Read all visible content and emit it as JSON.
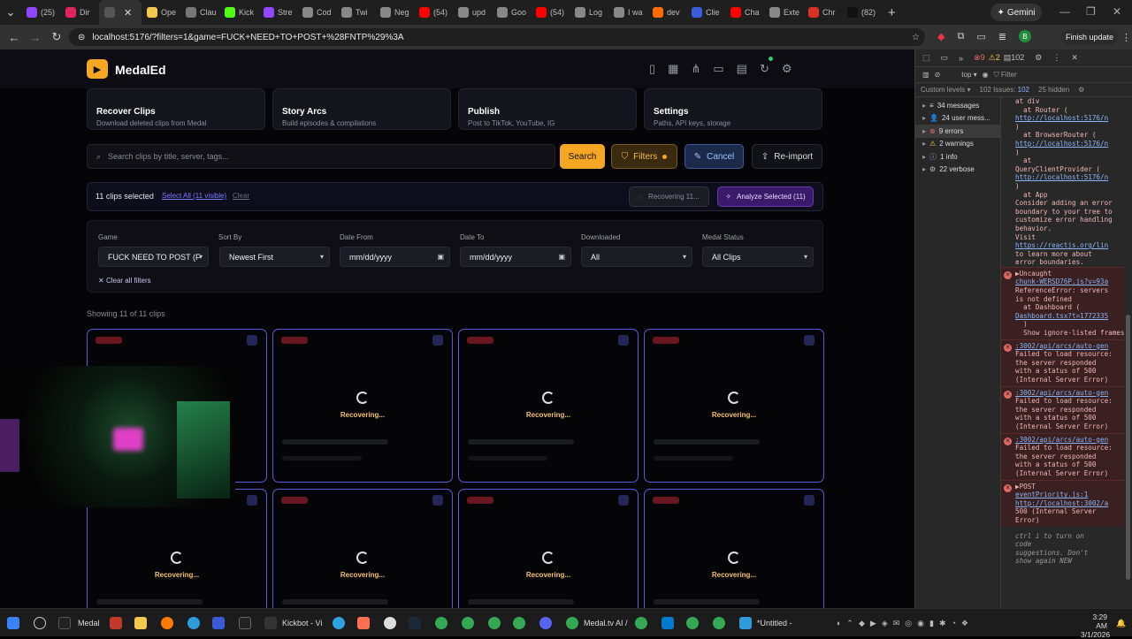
{
  "browser": {
    "tabs": [
      {
        "label": "(25)",
        "color": "#9146ff"
      },
      {
        "label": "Dir",
        "color": "#e0245e"
      },
      {
        "label": "",
        "color": "#555"
      },
      {
        "label": "Ope",
        "color": "#f2c94c"
      },
      {
        "label": "Clau",
        "color": "#777"
      },
      {
        "label": "Kick",
        "color": "#53fc18"
      },
      {
        "label": "Stre",
        "color": "#9146ff"
      },
      {
        "label": "Cod",
        "color": "#888"
      },
      {
        "label": "Twi",
        "color": "#888"
      },
      {
        "label": "Neg",
        "color": "#888"
      },
      {
        "label": "(54)",
        "color": "#ff0000"
      },
      {
        "label": "upd",
        "color": "#888"
      },
      {
        "label": "Goo",
        "color": "#888"
      },
      {
        "label": "(54)",
        "color": "#ff0000"
      },
      {
        "label": "Log",
        "color": "#888"
      },
      {
        "label": "I wa",
        "color": "#888"
      },
      {
        "label": "dev",
        "color": "#ff6a00"
      },
      {
        "label": "Clie",
        "color": "#3b5bdb"
      },
      {
        "label": "Cha",
        "color": "#ff0000"
      },
      {
        "label": "Exte",
        "color": "#888"
      },
      {
        "label": "Chr",
        "color": "#d93025"
      },
      {
        "label": "(82)",
        "color": "#111"
      }
    ],
    "gemini_label": "Gemini",
    "url": "localhost:5176/?filters=1&game=FUCK+NEED+TO+POST+%28FNTP%29%3A",
    "finish_update": "Finish update",
    "avatar_letter": "B"
  },
  "app": {
    "title": "MedalEd",
    "cards": [
      {
        "title": "Recover Clips",
        "subtitle": "Download deleted clips from Medal"
      },
      {
        "title": "Story Arcs",
        "subtitle": "Build episodes & compilations"
      },
      {
        "title": "Publish",
        "subtitle": "Post to TikTok, YouTube, IG"
      },
      {
        "title": "Settings",
        "subtitle": "Paths, API keys, storage"
      }
    ],
    "search_placeholder": "Search clips by title, server, tags...",
    "buttons": {
      "search": "Search",
      "filters": "Filters",
      "cancel": "Cancel",
      "reimport": "Re-import"
    },
    "selection": {
      "count": "11 clips selected",
      "select_all": "Select All (11 visible)",
      "clear": "Clear",
      "recovering": "Recovering 11...",
      "analyze": "Analyze Selected (11)"
    },
    "filters": {
      "game_label": "Game",
      "game_value": "FUCK NEED TO POST (F",
      "sort_label": "Sort By",
      "sort_value": "Newest First",
      "from_label": "Date From",
      "from_value": "mm/dd/yyyy",
      "to_label": "Date To",
      "to_value": "mm/dd/yyyy",
      "downloaded_label": "Downloaded",
      "downloaded_value": "All",
      "status_label": "Medal Status",
      "status_value": "All Clips",
      "clear_all": "Clear all filters"
    },
    "showing": "Showing 11 of 11 clips",
    "recovering_text": "Recovering..."
  },
  "devtools": {
    "counts": {
      "errors": "9",
      "warnings": "2",
      "messages": "102"
    },
    "context": "top",
    "filter": "Filter",
    "custom_levels": "Custom levels",
    "issues": "102 Issues:",
    "issues_count": "102",
    "hidden": "25 hidden",
    "sidebar": [
      {
        "label": "34 messages"
      },
      {
        "label": "24 user mess..."
      },
      {
        "label": "9 errors"
      },
      {
        "label": "2 warnings"
      },
      {
        "label": "1 info"
      },
      {
        "label": "22 verbose"
      }
    ],
    "log_lines": [
      "at div",
      "  at Router (",
      "http://localhost:5176/n",
      ")",
      "  at BrowserRouter (",
      "http://localhost:5176/n",
      ")",
      "  at",
      "QueryClientProvider (",
      "http://localhost:5176/n",
      ")",
      "  at App",
      "",
      "Consider adding an error",
      "boundary to your tree to",
      "customize error handling",
      "behavior.",
      "Visit",
      "https://reactjs.org/lin",
      "to learn more about",
      "error boundaries."
    ],
    "errors": [
      {
        "lines": [
          "▶Uncaught",
          "chunk-WERSD76P.js?v=93a",
          "ReferenceError: servers",
          "is not defined",
          "  at Dashboard (",
          "Dashboard.tsx?t=1772335",
          "  )",
          "  Show ignore-listed frames"
        ]
      },
      {
        "lines": [
          ":3002/api/arcs/auto-gen",
          "",
          "Failed to load resource:",
          "the server responded",
          "with a status of 500",
          "(Internal Server Error)"
        ]
      },
      {
        "lines": [
          ":3002/api/arcs/auto-gen",
          "",
          "Failed to load resource:",
          "the server responded",
          "with a status of 500",
          "(Internal Server Error)"
        ]
      },
      {
        "lines": [
          ":3002/api/arcs/auto-gen",
          "",
          "Failed to load resource:",
          "the server responded",
          "with a status of 500",
          "(Internal Server Error)"
        ]
      },
      {
        "lines": [
          "▶POST",
          "eventPriority.js:1",
          "http://localhost:3002/a",
          "500 (Internal Server",
          "Error)"
        ]
      }
    ],
    "hint": [
      "ctrl i to turn on",
      "code",
      "suggestions. Don't",
      "show again NEW"
    ]
  },
  "taskbar": {
    "medal": "Medal",
    "kickbot": "Kickbot - Vi",
    "chrome_tab": "Medal.tv AI /",
    "untitled": "*Untitled -",
    "time": "3:29 AM",
    "date": "3/1/2026"
  }
}
